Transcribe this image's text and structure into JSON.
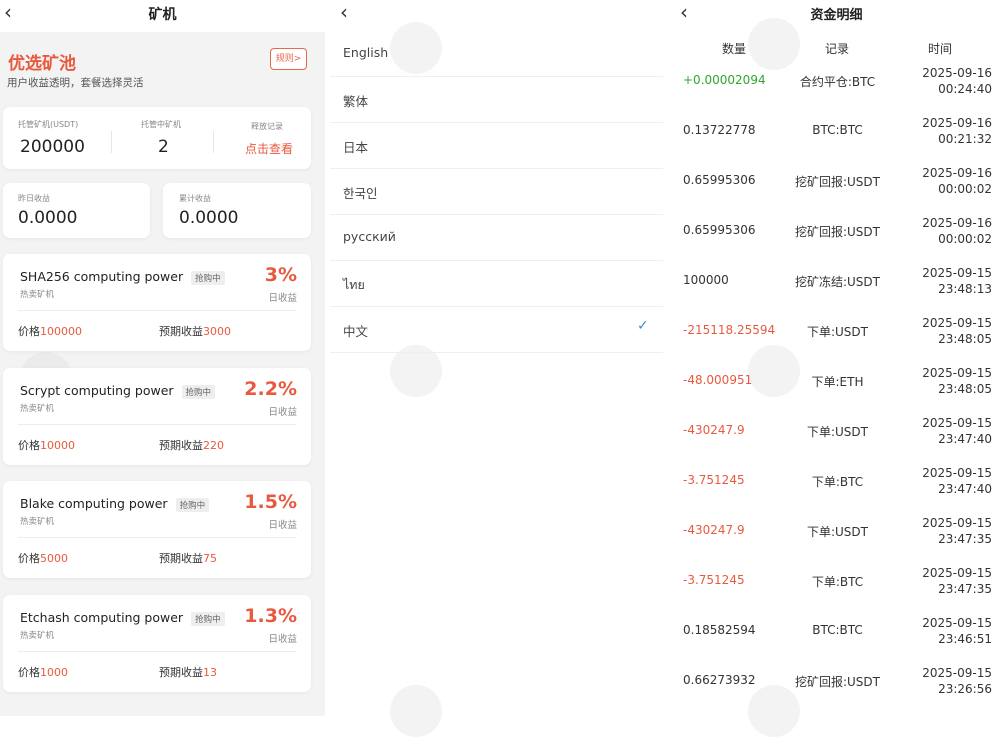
{
  "miner": {
    "title": "矿机",
    "pool_title": "优选矿池",
    "pool_subtitle": "用户收益透明，套餐选择灵活",
    "rules_label": "规则>",
    "stats": {
      "hosted_label": "托管矿机(USDT)",
      "hosted_value": "200000",
      "hosting_label": "托管中矿机",
      "hosting_value": "2",
      "release_label": "释放记录",
      "release_link": "点击查看"
    },
    "income": {
      "yesterday_label": "昨日收益",
      "yesterday_value": "0.0000",
      "total_label": "累计收益",
      "total_value": "0.0000"
    },
    "machines": [
      {
        "name": "SHA256 computing power",
        "badge": "抢购中",
        "sub": "热卖矿机",
        "rate": "3%",
        "rate_label": "日收益",
        "price_label": "价格",
        "price": "100000",
        "expected_label": "预期收益",
        "expected": "3000"
      },
      {
        "name": "Scrypt computing power",
        "badge": "抢购中",
        "sub": "热卖矿机",
        "rate": "2.2%",
        "rate_label": "日收益",
        "price_label": "价格",
        "price": "10000",
        "expected_label": "预期收益",
        "expected": "220"
      },
      {
        "name": "Blake computing power",
        "badge": "抢购中",
        "sub": "热卖矿机",
        "rate": "1.5%",
        "rate_label": "日收益",
        "price_label": "价格",
        "price": "5000",
        "expected_label": "预期收益",
        "expected": "75"
      },
      {
        "name": "Etchash computing power",
        "badge": "抢购中",
        "sub": "热卖矿机",
        "rate": "1.3%",
        "rate_label": "日收益",
        "price_label": "价格",
        "price": "1000",
        "expected_label": "预期收益",
        "expected": "13"
      }
    ]
  },
  "language": {
    "options": [
      "English",
      "繁体",
      "日本",
      "한국인",
      "русский",
      "ไทย",
      "中文"
    ],
    "selected": "中文"
  },
  "funds": {
    "title": "资金明细",
    "headers": {
      "amount": "数量",
      "record": "记录",
      "time": "时间"
    },
    "rows": [
      {
        "amount": "+0.00002094",
        "record": "合约平仓:BTC",
        "date": "2025-09-16",
        "clock": "00:24:40",
        "tone": "pos"
      },
      {
        "amount": "0.13722778",
        "record": "BTC:BTC",
        "date": "2025-09-16",
        "clock": "00:21:32",
        "tone": "neu"
      },
      {
        "amount": "0.65995306",
        "record": "挖矿回报:USDT",
        "date": "2025-09-16",
        "clock": "00:00:02",
        "tone": "neu"
      },
      {
        "amount": "0.65995306",
        "record": "挖矿回报:USDT",
        "date": "2025-09-16",
        "clock": "00:00:02",
        "tone": "neu"
      },
      {
        "amount": "100000",
        "record": "挖矿冻结:USDT",
        "date": "2025-09-15",
        "clock": "23:48:13",
        "tone": "neu"
      },
      {
        "amount": "-215118.25594",
        "record": "下单:USDT",
        "date": "2025-09-15",
        "clock": "23:48:05",
        "tone": "neg"
      },
      {
        "amount": "-48.000951",
        "record": "下单:ETH",
        "date": "2025-09-15",
        "clock": "23:48:05",
        "tone": "neg"
      },
      {
        "amount": "-430247.9",
        "record": "下单:USDT",
        "date": "2025-09-15",
        "clock": "23:47:40",
        "tone": "neg"
      },
      {
        "amount": "-3.751245",
        "record": "下单:BTC",
        "date": "2025-09-15",
        "clock": "23:47:40",
        "tone": "neg"
      },
      {
        "amount": "-430247.9",
        "record": "下单:USDT",
        "date": "2025-09-15",
        "clock": "23:47:35",
        "tone": "neg"
      },
      {
        "amount": "-3.751245",
        "record": "下单:BTC",
        "date": "2025-09-15",
        "clock": "23:47:35",
        "tone": "neg"
      },
      {
        "amount": "0.18582594",
        "record": "BTC:BTC",
        "date": "2025-09-15",
        "clock": "23:46:51",
        "tone": "neu"
      },
      {
        "amount": "0.66273932",
        "record": "挖矿回报:USDT",
        "date": "2025-09-15",
        "clock": "23:26:56",
        "tone": "neu"
      }
    ]
  },
  "icons": {
    "back": "chevron-left-icon",
    "check": "checkmark-icon"
  },
  "colors": {
    "accent": "#e85a3f",
    "positive": "#2ea82e",
    "check": "#3b8ed8"
  }
}
